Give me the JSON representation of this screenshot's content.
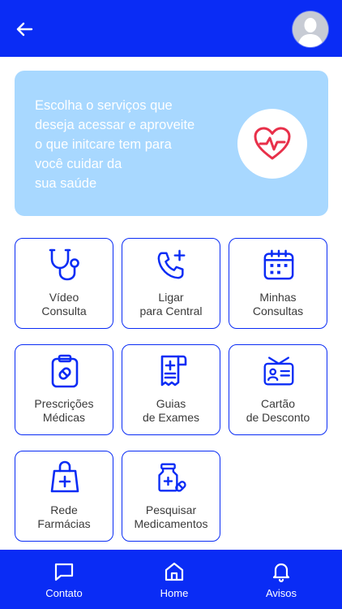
{
  "colors": {
    "primary": "#0a2cf5",
    "banner_bg": "#a8d8ff",
    "heart": "#e8304a"
  },
  "header": {
    "back_icon": "arrow-left-icon",
    "avatar_icon": "user-avatar-icon"
  },
  "banner": {
    "text": "Escolha o serviços que\ndeseja acessar e aproveite\no que initcare tem para\n você cuidar da\nsua saúde",
    "icon": "heart-pulse-icon"
  },
  "services": [
    {
      "label": "Vídeo\nConsulta",
      "icon": "stethoscope-icon"
    },
    {
      "label": "Ligar\npara Central",
      "icon": "phone-plus-icon"
    },
    {
      "label": "Minhas\nConsultas",
      "icon": "calendar-icon"
    },
    {
      "label": "Prescrições\nMédicas",
      "icon": "clipboard-pill-icon"
    },
    {
      "label": "Guias\nde Exames",
      "icon": "receipt-icon"
    },
    {
      "label": "Cartão\nde Desconto",
      "icon": "id-card-icon"
    },
    {
      "label": "Rede\nFarmácias",
      "icon": "shopping-bag-plus-icon"
    },
    {
      "label": "Pesquisar\nMedicamentos",
      "icon": "medicine-bottle-icon"
    }
  ],
  "bottom_nav": [
    {
      "label": "Contato",
      "icon": "chat-icon"
    },
    {
      "label": "Home",
      "icon": "home-icon"
    },
    {
      "label": "Avisos",
      "icon": "bell-icon"
    }
  ]
}
